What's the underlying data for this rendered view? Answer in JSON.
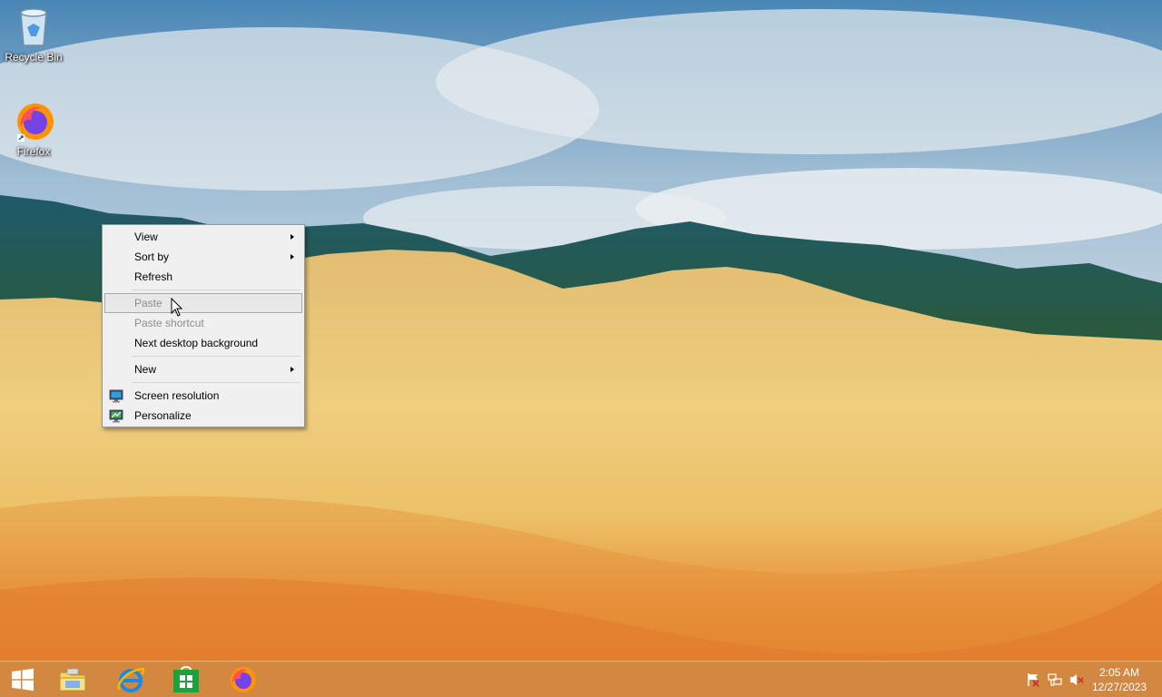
{
  "desktop": {
    "icons": [
      {
        "label": "Recycle Bin",
        "icon": "recycle-bin-icon"
      },
      {
        "label": "Firefox",
        "icon": "firefox-icon"
      }
    ]
  },
  "context_menu": {
    "items": [
      {
        "label": "View",
        "submenu": true,
        "enabled": true
      },
      {
        "label": "Sort by",
        "submenu": true,
        "enabled": true
      },
      {
        "label": "Refresh",
        "enabled": true
      },
      {
        "label": "Paste",
        "enabled": false,
        "highlighted": true
      },
      {
        "label": "Paste shortcut",
        "enabled": false
      },
      {
        "label": "Next desktop background",
        "enabled": true
      },
      {
        "label": "New",
        "submenu": true,
        "enabled": true
      },
      {
        "label": "Screen resolution",
        "enabled": true,
        "icon": "monitor-icon"
      },
      {
        "label": "Personalize",
        "enabled": true,
        "icon": "personalize-icon"
      }
    ]
  },
  "taskbar": {
    "pinned": [
      "start-button",
      "file-explorer-icon",
      "internet-explorer-icon",
      "store-icon",
      "firefox-icon"
    ],
    "tray": [
      "action-center-flag-icon",
      "network-icon",
      "volume-muted-icon"
    ],
    "clock": {
      "time": "2:05 AM",
      "date": "12/27/2023"
    }
  },
  "colors": {
    "taskbar": "#cd8c46",
    "menu_bg": "#f0f0f0",
    "disabled_text": "#8d8d8d"
  }
}
